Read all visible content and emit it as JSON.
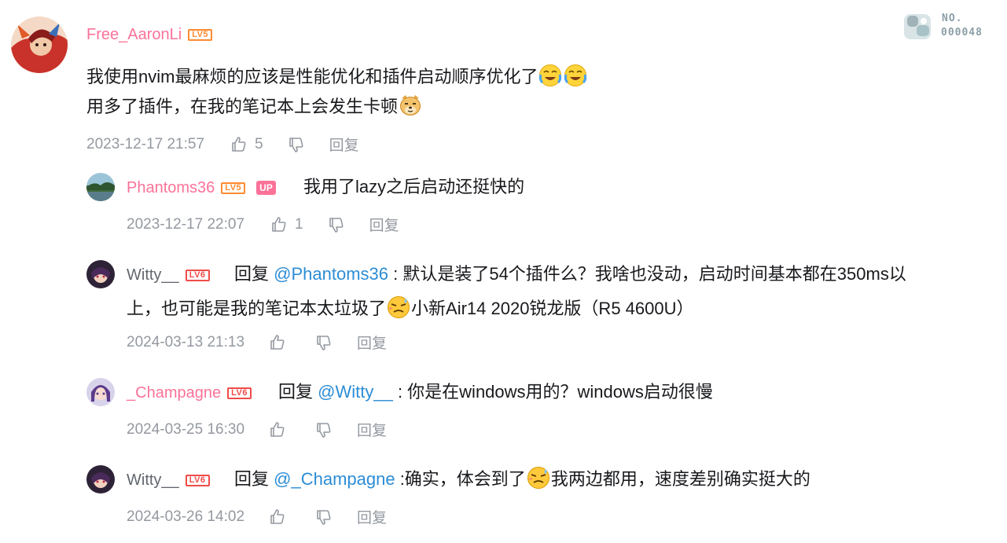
{
  "colors": {
    "username_pink": "#fb7299",
    "username_gray": "#61666d",
    "mention_blue": "#2c8dd5",
    "meta_gray": "#9499a0",
    "lv5": "#ff8a30",
    "lv6": "#f04c49"
  },
  "stamp": {
    "title": "NO.",
    "number": "000048"
  },
  "main_comment": {
    "username": "Free_AaronLi",
    "level": "LV5",
    "line1": "我使用nvim最麻烦的应该是性能优化和插件启动顺序优化了",
    "line1_emotes": [
      "cry-laugh-emote",
      "cry-laugh-emote"
    ],
    "line2": "用多了插件，在我的笔记本上会发生卡顿",
    "line2_emote": "doge-emote",
    "time": "2023-12-17 21:57",
    "likes": "5",
    "reply_label": "回复"
  },
  "replies": [
    {
      "username": "Phantoms36",
      "level": "LV5",
      "up_badge": "UP",
      "text": "我用了lazy之后启动还挺快的",
      "time": "2023-12-17 22:07",
      "likes": "1",
      "reply_label": "回复"
    },
    {
      "username": "Witty__",
      "level": "LV6",
      "reply_prefix": "回复",
      "mention": "@Phantoms36",
      "text_a": " : 默认是装了54个插件么？我啥也没动，启动时间基本都在350ms以",
      "text_b": "上，也可能是我的笔记本太垃圾了",
      "emote": "sweat-emote",
      "text_c": "小新Air14 2020锐龙版（R5 4600U）",
      "time": "2024-03-13 21:13",
      "reply_label": "回复"
    },
    {
      "username": "_Champagne",
      "level": "LV6",
      "reply_prefix": "回复",
      "mention": "@Witty__",
      "text": " : 你是在windows用的？windows启动很慢",
      "time": "2024-03-25 16:30",
      "reply_label": "回复"
    },
    {
      "username": "Witty__",
      "level": "LV6",
      "reply_prefix": "回复",
      "mention": "@_Champagne",
      "text_a": " :确实，体会到了",
      "emote": "sweat-emote",
      "text_b": "我两边都用，速度差别确实挺大的",
      "time": "2024-03-26 14:02",
      "reply_label": "回复"
    }
  ]
}
